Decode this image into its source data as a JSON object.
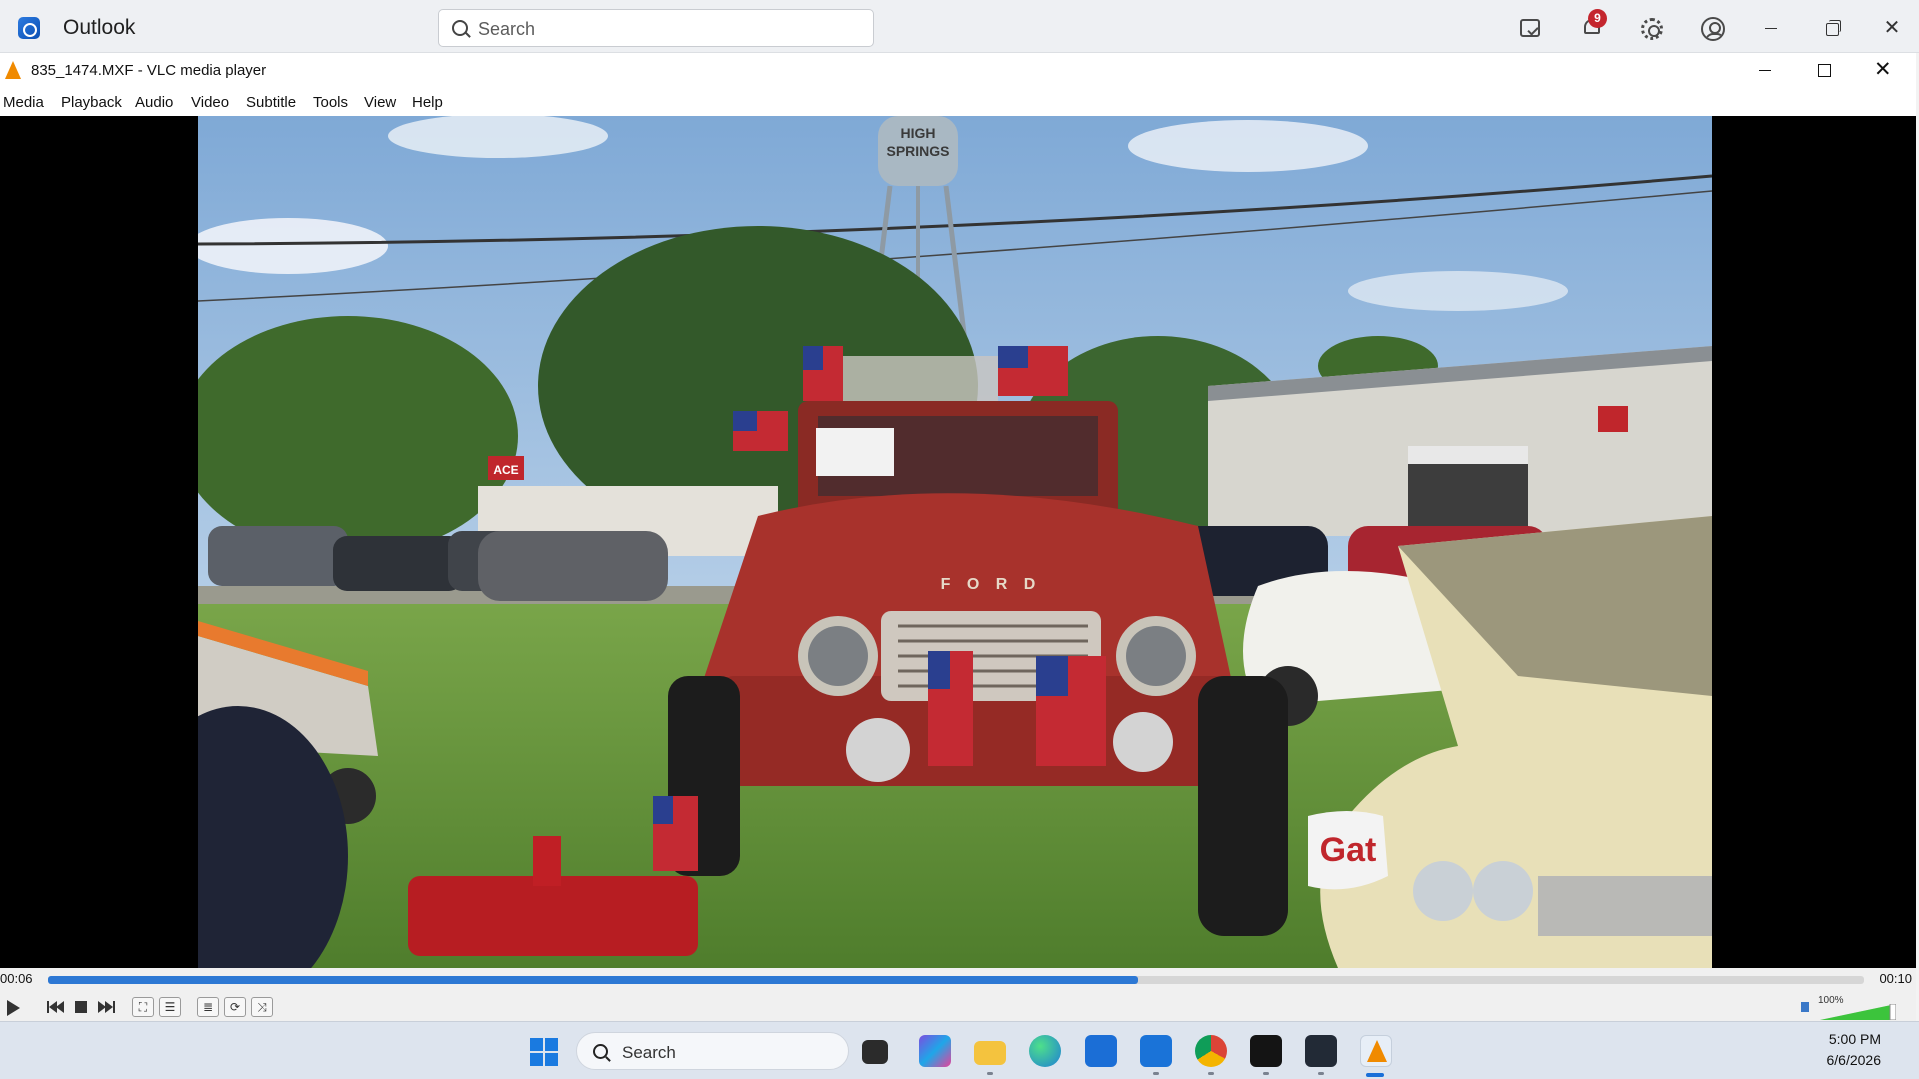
{
  "outlook": {
    "title": "Outlook",
    "search_placeholder": "Search",
    "notification_count": "9",
    "icons": [
      "outlook-logo-icon",
      "todo-icon",
      "bell-icon",
      "gear-icon",
      "account-icon",
      "minimize-icon",
      "restore-icon",
      "close-icon"
    ]
  },
  "vlc": {
    "window_title": "835_1474.MXF - VLC media player",
    "menu": [
      "Media",
      "Playback",
      "Audio",
      "Video",
      "Subtitle",
      "Tools",
      "View",
      "Help"
    ],
    "video": {
      "water_tower_text_line1": "HIGH",
      "water_tower_text_line2": "SPRINGS",
      "grille_text": "F O R D",
      "store_sign": "ACE",
      "boat_text": "Gat"
    },
    "controls": {
      "time_elapsed": "00:06",
      "time_total": "00:10",
      "progress": 0.6,
      "volume_label": "100%",
      "volume": 1.0,
      "buttons": [
        "play",
        "previous",
        "stop",
        "next",
        "fullscreen",
        "extended-settings",
        "playlist",
        "loop",
        "random"
      ]
    },
    "colors": {
      "accent": "#2d78d4",
      "cone": "#f08a00"
    }
  },
  "taskbar": {
    "search_placeholder": "Search",
    "apps": [
      "start",
      "task-view",
      "microsoft-365",
      "file-explorer",
      "edge",
      "microsoft-store",
      "outlook",
      "chrome",
      "ap-news",
      "davinci-resolve",
      "vlc"
    ],
    "time": "5:00 PM",
    "date": "6/6/2026"
  }
}
